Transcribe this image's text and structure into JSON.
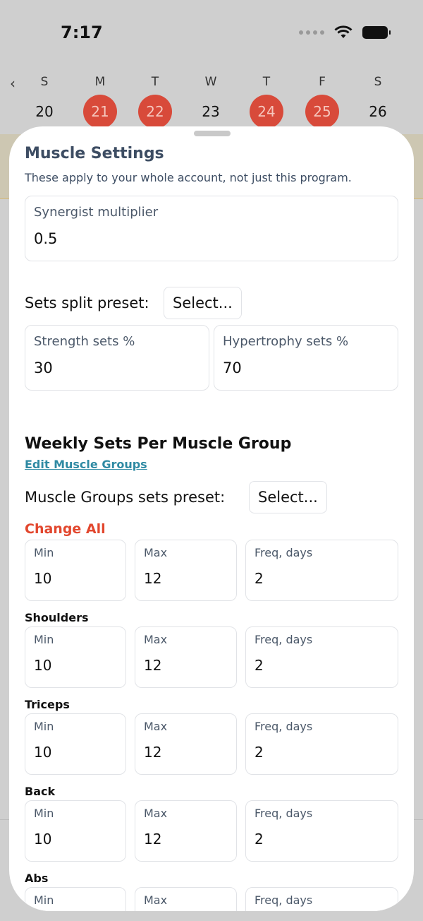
{
  "status": {
    "time": "7:17"
  },
  "week": {
    "back_icon": "chevron-left-icon",
    "days": [
      {
        "letter": "S",
        "num": "20",
        "active": false
      },
      {
        "letter": "M",
        "num": "21",
        "active": true
      },
      {
        "letter": "T",
        "num": "22",
        "active": true
      },
      {
        "letter": "W",
        "num": "23",
        "active": false
      },
      {
        "letter": "T",
        "num": "24",
        "active": true
      },
      {
        "letter": "F",
        "num": "25",
        "active": true
      },
      {
        "letter": "S",
        "num": "26",
        "active": false
      }
    ]
  },
  "settings": {
    "title": "Muscle Settings",
    "subtitle": "These apply to your whole account, not just this program.",
    "synergist_label": "Synergist multiplier",
    "synergist_value": "0.5",
    "split_preset_label": "Sets split preset:",
    "split_preset_select": "Select...",
    "strength_label": "Strength sets %",
    "strength_value": "30",
    "hypertrophy_label": "Hypertrophy sets %",
    "hypertrophy_value": "70"
  },
  "weekly": {
    "title": "Weekly Sets Per Muscle Group",
    "edit_link": "Edit Muscle Groups",
    "groups_preset_label": "Muscle Groups sets preset:",
    "groups_preset_select": "Select...",
    "change_all": "Change All",
    "min_label": "Min",
    "max_label": "Max",
    "freq_label": "Freq, days",
    "all": {
      "min": "10",
      "max": "12",
      "freq": "2"
    },
    "groups": [
      {
        "name": "Shoulders",
        "min": "10",
        "max": "12",
        "freq": "2"
      },
      {
        "name": "Triceps",
        "min": "10",
        "max": "12",
        "freq": "2"
      },
      {
        "name": "Back",
        "min": "10",
        "max": "12",
        "freq": "2"
      },
      {
        "name": "Abs",
        "min": "",
        "max": "",
        "freq": ""
      }
    ]
  },
  "colors": {
    "accent_red": "#d84a3a",
    "link_teal": "#2f8aa3",
    "change_all_red": "#e2472e",
    "heading_slate": "#3d4d63"
  }
}
